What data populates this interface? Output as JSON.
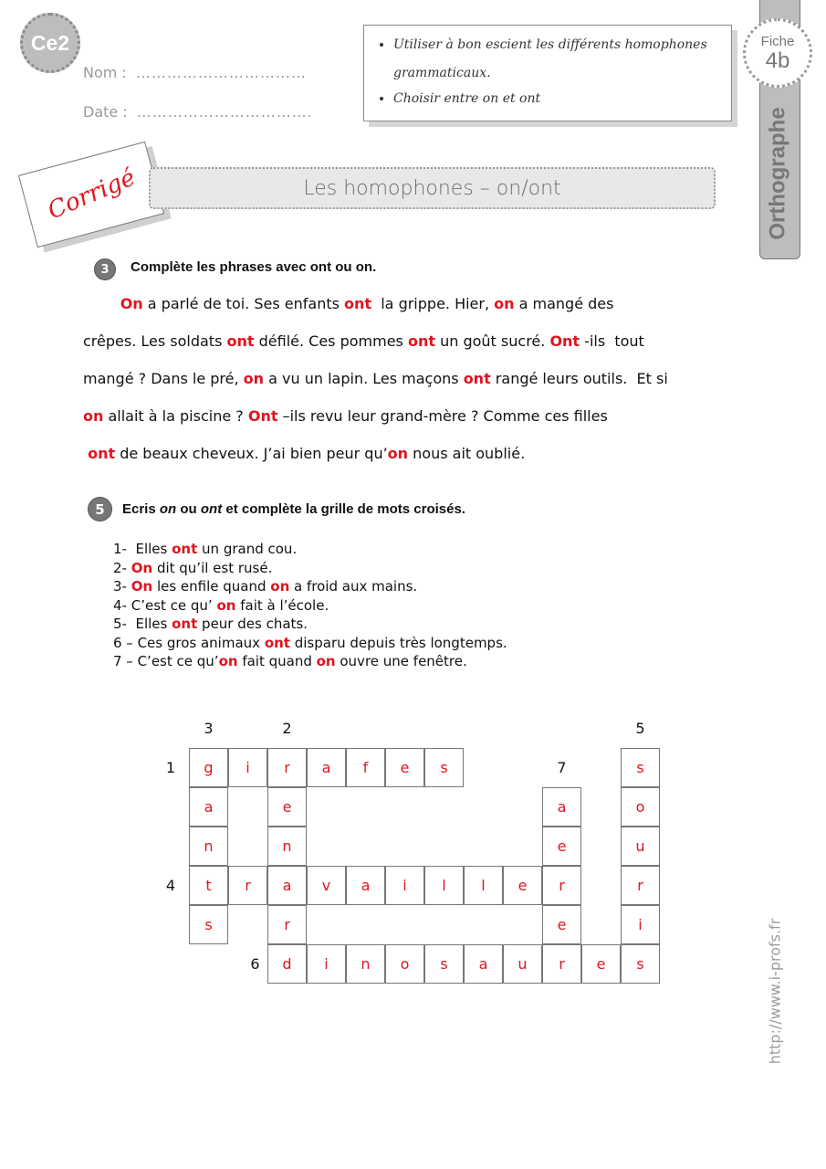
{
  "header": {
    "level_badge": "Ce2",
    "name_label": "Nom :",
    "name_dots": "……………………………",
    "date_label": "Date :",
    "date_dots": "……………………………."
  },
  "objectives": [
    "Utiliser à bon escient les différents homophones grammaticaux.",
    "Choisir entre on et ont"
  ],
  "side_tab": {
    "fiche_label": "Fiche",
    "fiche_number": "4b",
    "subject": "Orthographe"
  },
  "corrige_label": "Corrigé",
  "title": "Les homophones – on/ont",
  "exercise3": {
    "number": "3",
    "instruction": "Complète les phrases avec ont ou on.",
    "lines": [
      [
        {
          "t": "        "
        },
        {
          "t": "On",
          "a": true
        },
        {
          "t": " a parlé de toi. Ses enfants "
        },
        {
          "t": "ont",
          "a": true
        },
        {
          "t": "  la grippe. Hier, "
        },
        {
          "t": "on",
          "a": true
        },
        {
          "t": " a mangé des"
        }
      ],
      [
        {
          "t": "crêpes. Les soldats "
        },
        {
          "t": "ont",
          "a": true
        },
        {
          "t": " défilé. Ces pommes "
        },
        {
          "t": "ont",
          "a": true
        },
        {
          "t": " un goût sucré. "
        },
        {
          "t": "Ont",
          "a": true
        },
        {
          "t": " -ils  tout"
        }
      ],
      [
        {
          "t": "mangé ? Dans le pré, "
        },
        {
          "t": "on",
          "a": true
        },
        {
          "t": " a vu un lapin. Les maçons "
        },
        {
          "t": "ont",
          "a": true
        },
        {
          "t": " rangé leurs outils.  Et si"
        }
      ],
      [
        {
          "t": "on",
          "a": true
        },
        {
          "t": " allait à la piscine ? "
        },
        {
          "t": "Ont",
          "a": true
        },
        {
          "t": " –ils revu leur grand-mère ? Comme ces filles"
        }
      ],
      [
        {
          "t": " "
        },
        {
          "t": "ont",
          "a": true
        },
        {
          "t": " de beaux cheveux. J’ai bien peur qu’"
        },
        {
          "t": "on",
          "a": true
        },
        {
          "t": " nous ait oublié."
        }
      ]
    ]
  },
  "exercise5": {
    "number": "5",
    "instruction_parts": [
      {
        "t": "Ecris ",
        "i": false
      },
      {
        "t": "on",
        "i": true
      },
      {
        "t": " ou ",
        "i": false
      },
      {
        "t": "ont",
        "i": true
      },
      {
        "t": " et complète la grille de mots croisés.",
        "i": false
      }
    ],
    "clues": [
      [
        {
          "t": "1-  Elles "
        },
        {
          "t": "ont",
          "a": true
        },
        {
          "t": " un grand cou."
        }
      ],
      [
        {
          "t": "2- "
        },
        {
          "t": "On",
          "a": true
        },
        {
          "t": " dit qu’il est rusé."
        }
      ],
      [
        {
          "t": "3- "
        },
        {
          "t": "On",
          "a": true
        },
        {
          "t": " les enfile quand "
        },
        {
          "t": "on",
          "a": true
        },
        {
          "t": " a froid aux mains."
        }
      ],
      [
        {
          "t": "4- C’est ce qu’ "
        },
        {
          "t": "on",
          "a": true
        },
        {
          "t": " fait à l’école."
        }
      ],
      [
        {
          "t": "5-  Elles "
        },
        {
          "t": "ont",
          "a": true
        },
        {
          "t": " peur des chats."
        }
      ],
      [
        {
          "t": "6 – Ces gros animaux "
        },
        {
          "t": "ont",
          "a": true
        },
        {
          "t": " disparu depuis très longtemps."
        }
      ],
      [
        {
          "t": "7 – C’est ce qu’"
        },
        {
          "t": "on",
          "a": true
        },
        {
          "t": " fait quand "
        },
        {
          "t": "on",
          "a": true
        },
        {
          "t": " ouvre une fenêtre."
        }
      ]
    ]
  },
  "crossword": {
    "rows": [
      "girafes    s",
      "a e      a o",
      "n n      e u",
      "travailler r",
      "s r      e i",
      "  dinosaures"
    ],
    "numbers": [
      {
        "label": "1",
        "row": 0,
        "col": -1
      },
      {
        "label": "3",
        "row": -1,
        "col": 0
      },
      {
        "label": "2",
        "row": -1,
        "col": 2
      },
      {
        "label": "5",
        "row": -1,
        "col": 11
      },
      {
        "label": "7",
        "row": 0,
        "col": 9
      },
      {
        "label": "4",
        "row": 3,
        "col": -1
      },
      {
        "label": "6",
        "row": 5,
        "col": 1
      }
    ],
    "answers": {
      "1": "girafes",
      "2": "renard",
      "3": "gants",
      "4": "travailler",
      "5": "souris",
      "6": "dinosaures",
      "7": "aérer"
    }
  },
  "website": "http://www.i-profs.fr",
  "colors": {
    "answer_red": "#e0141e",
    "badge_gray": "#bdbdbd"
  }
}
